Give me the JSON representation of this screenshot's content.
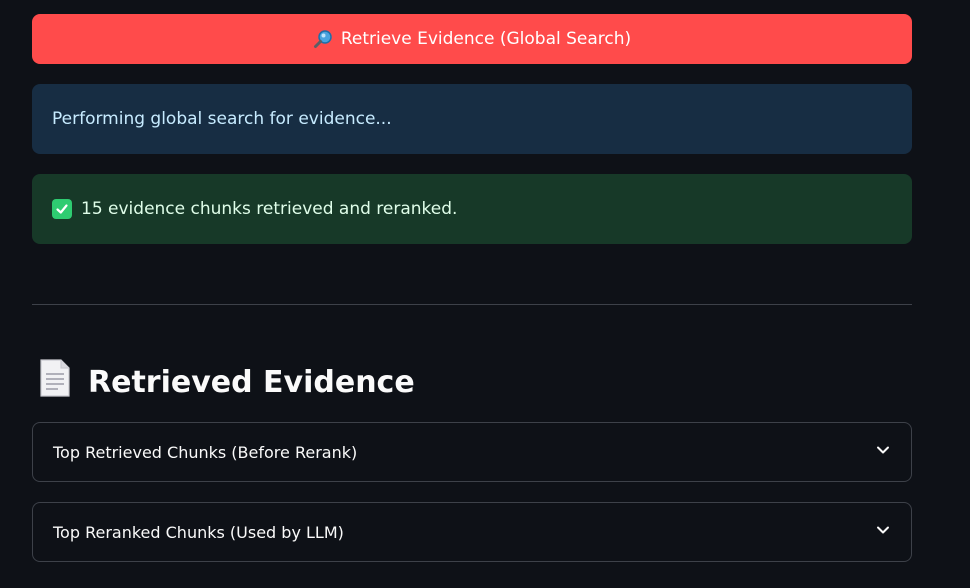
{
  "retrieve_button": {
    "label": "Retrieve Evidence (Global Search)",
    "icon": "magnifier-icon"
  },
  "alerts": {
    "info_text": "Performing global search for evidence...",
    "success_text": "15 evidence chunks retrieved and reranked.",
    "success_icon": "check-icon"
  },
  "section": {
    "title": "Retrieved Evidence",
    "icon": "document-icon"
  },
  "expanders": [
    {
      "label": "Top Retrieved Chunks (Before Rerank)",
      "icon": "chevron-down-icon"
    },
    {
      "label": "Top Reranked Chunks (Used by LLM)",
      "icon": "chevron-down-icon"
    }
  ],
  "colors": {
    "background": "#0e1117",
    "primary_button": "#ff4b4b",
    "info_bg": "#172d43",
    "success_bg": "#173928",
    "check": "#2ecc71"
  }
}
